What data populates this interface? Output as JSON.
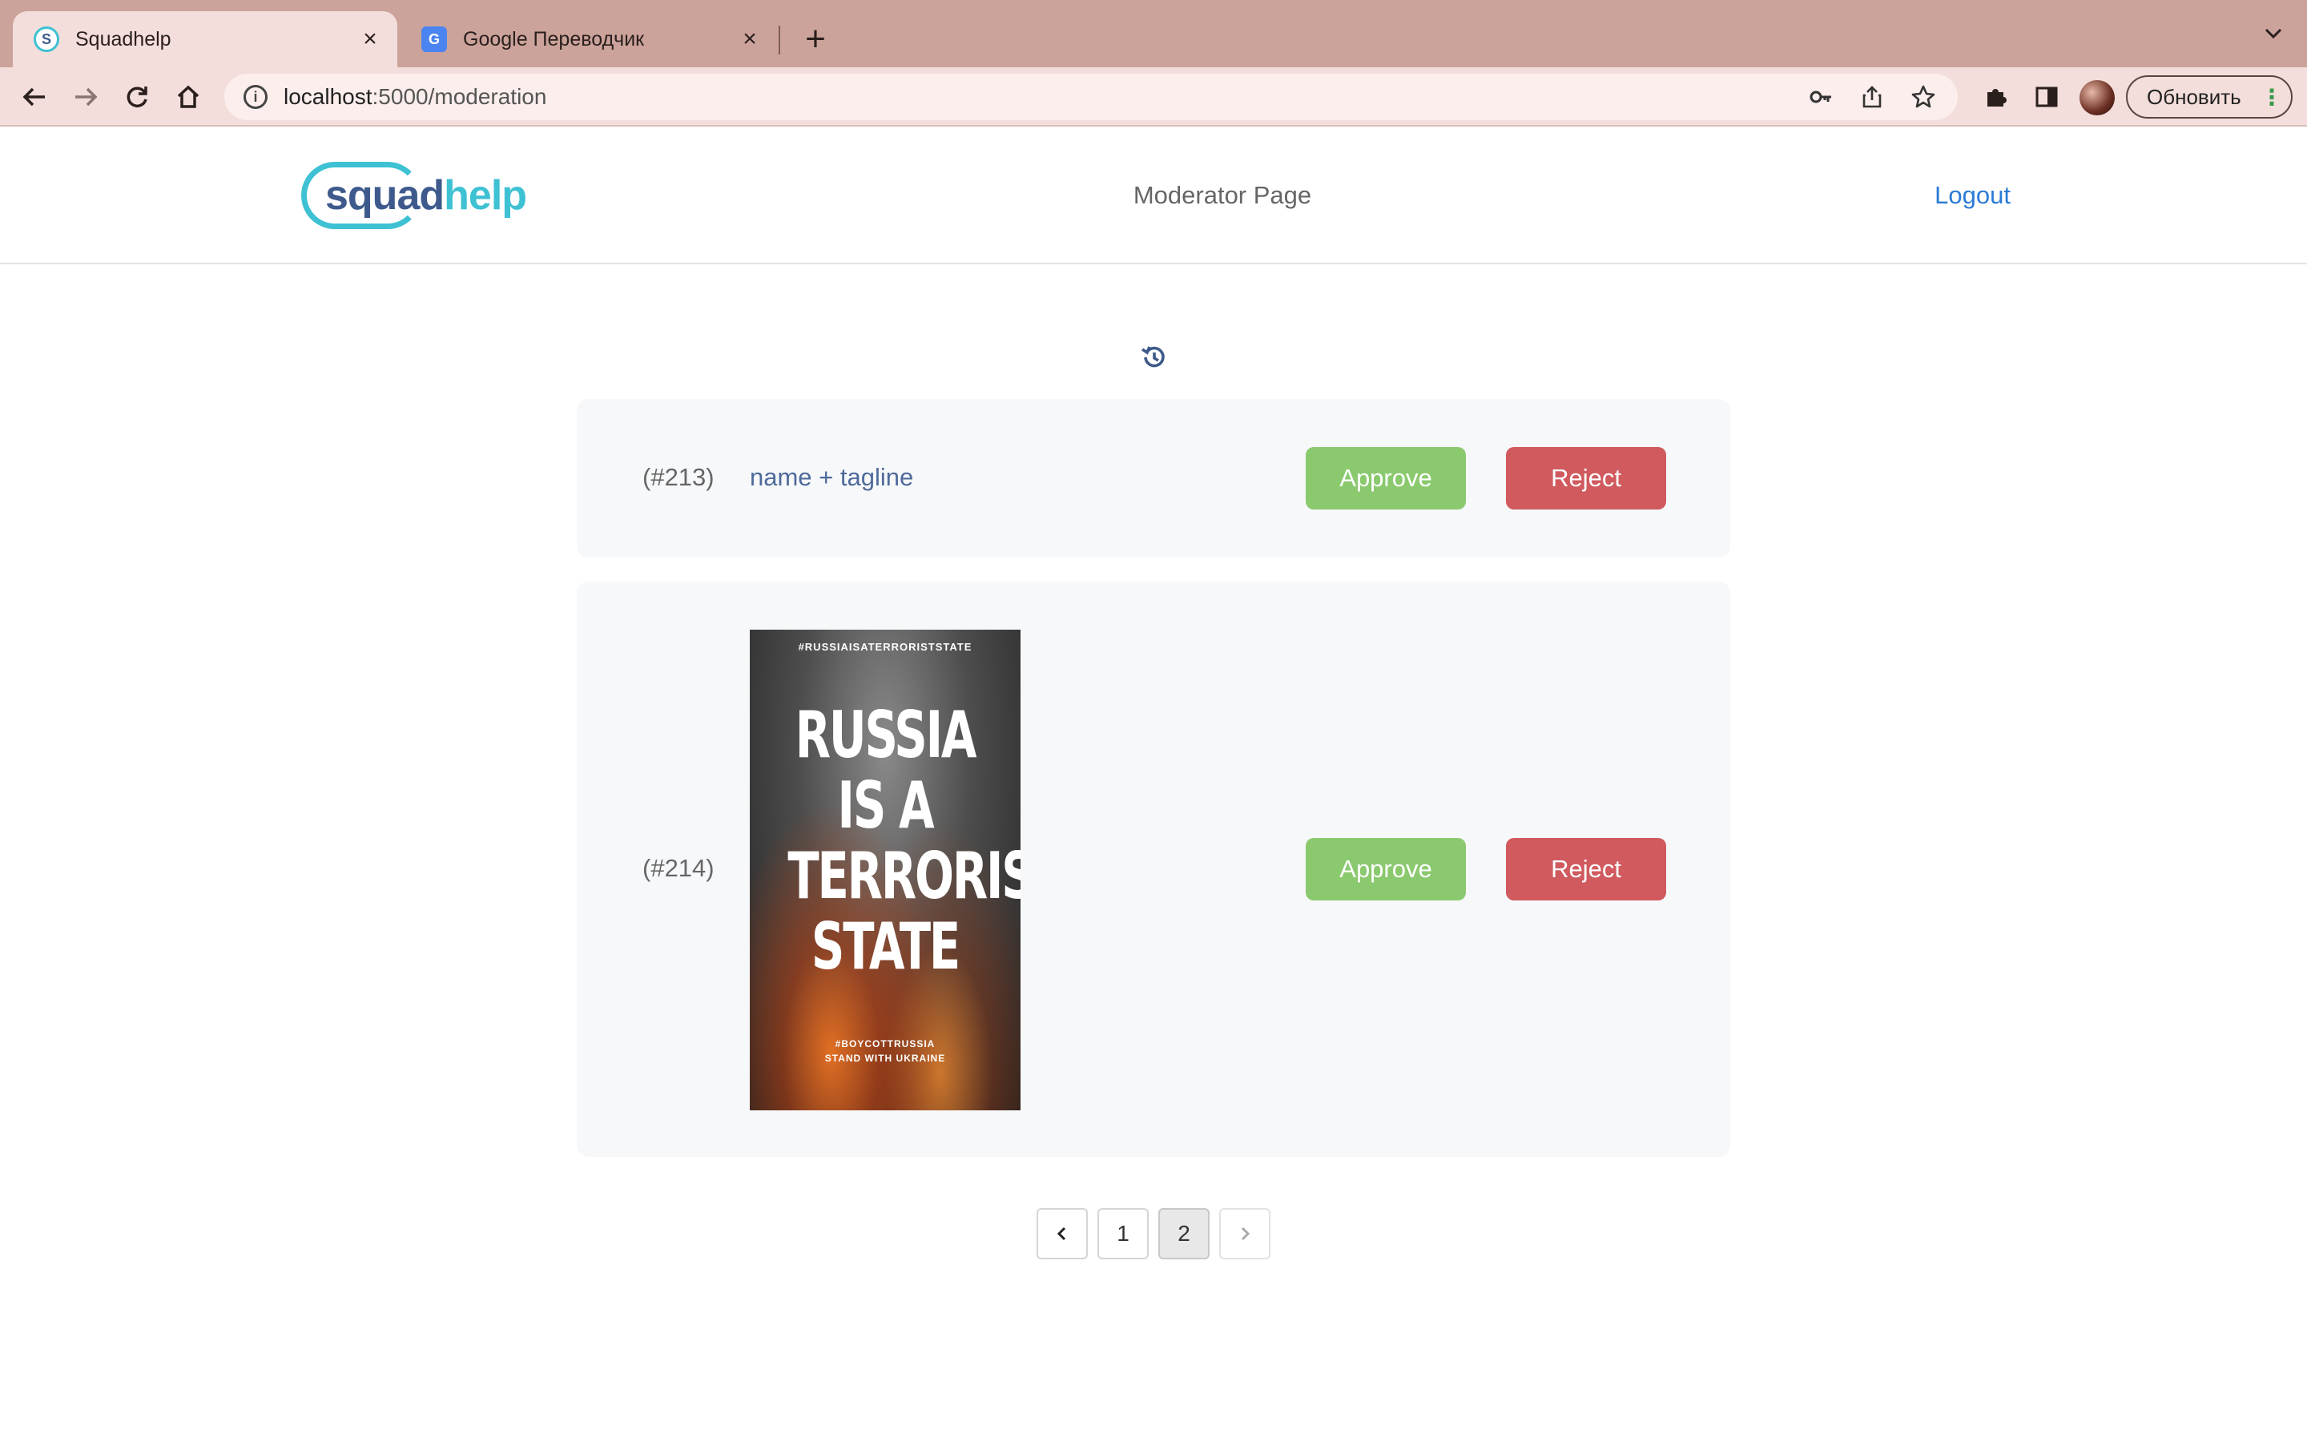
{
  "browser": {
    "tabs": [
      {
        "title": "Squadhelp",
        "favicon": "squadhelp-favicon",
        "active": true
      },
      {
        "title": "Google Переводчик",
        "favicon": "google-translate-favicon",
        "active": false
      }
    ],
    "url_host": "localhost",
    "url_rest": ":5000/moderation",
    "update_button": "Обновить",
    "icons": [
      "back-icon",
      "forward-icon",
      "reload-icon",
      "home-icon",
      "info-icon",
      "key-icon",
      "share-icon",
      "star-icon",
      "extensions-icon",
      "sidepanel-icon",
      "profile-avatar",
      "menu-dots-icon"
    ],
    "theme_color": "#cba39a"
  },
  "header": {
    "logo": {
      "part1": "squad",
      "part2": "help"
    },
    "title": "Moderator Page",
    "logout": "Logout"
  },
  "offers": [
    {
      "id": "(#213)",
      "text": "name + tagline",
      "approve": "Approve",
      "reject": "Reject"
    },
    {
      "id": "(#214)",
      "image": {
        "top": "#RUSSIAISATERRORISTSTATE",
        "lines": [
          "RUSSIA",
          "IS A",
          "TERRORIST",
          "STATE"
        ],
        "bottom1": "#BOYCOTTRUSSIA",
        "bottom2": "STAND WITH UKRAINE"
      },
      "approve": "Approve",
      "reject": "Reject"
    }
  ],
  "pagination": {
    "prev": "‹",
    "pages": [
      "1",
      "2"
    ],
    "current": "2",
    "next": "›"
  },
  "colors": {
    "approve": "#8bc96f",
    "reject": "#d05a5e",
    "link": "#2b7bd6"
  }
}
